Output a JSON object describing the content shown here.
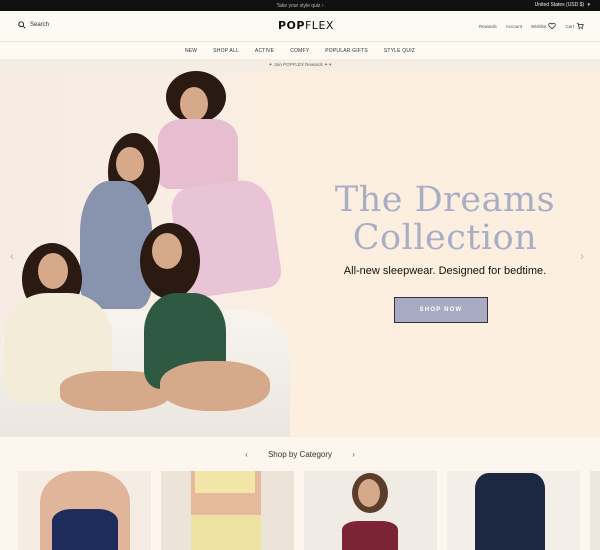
{
  "topbar": {
    "promo": "Take your style quiz ›",
    "region": "United States (USD $)"
  },
  "header": {
    "search_label": "Search",
    "logo_bold": "POP",
    "logo_thin": "FLEX",
    "rewards_link": "Rewards",
    "account_link": "Account",
    "wishlist_link": "Wishlist",
    "cart_link": "Cart"
  },
  "nav": {
    "items": [
      "NEW",
      "SHOP ALL",
      "ACTIVE",
      "COMFY",
      "POPULAR GIFTS",
      "STYLE QUIZ"
    ]
  },
  "rewards_bar": {
    "text": "✦ Join POPFLEX Rewards ✦"
  },
  "hero": {
    "title_line1": "The Dreams",
    "title_line2": "Collection",
    "subtitle": "All-new sleepwear. Designed for bedtime.",
    "cta": "SHOP NOW",
    "accent": "#a9abc5"
  },
  "categories": {
    "heading": "Shop by Category"
  },
  "colors": {
    "background": "#fdefdf",
    "title": "#a9adc6",
    "button": "#a9abc5",
    "topbar": "#111111"
  }
}
